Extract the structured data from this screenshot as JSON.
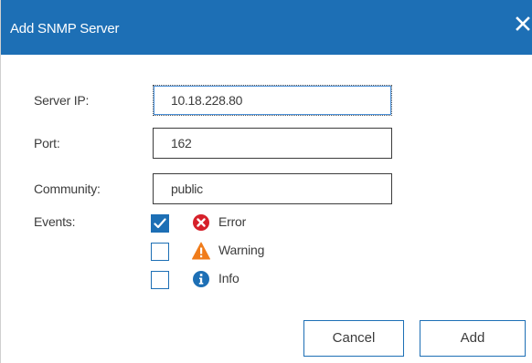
{
  "dialog": {
    "title": "Add SNMP Server",
    "close_glyph": "✕"
  },
  "form": {
    "server_ip_label": "Server IP:",
    "server_ip_value": "10.18.228.80",
    "port_label": "Port:",
    "port_value": "162",
    "community_label": "Community:",
    "community_value": "public",
    "events_label": "Events:"
  },
  "events": [
    {
      "label": "Error",
      "checked": true,
      "icon": "error-icon"
    },
    {
      "label": "Warning",
      "checked": false,
      "icon": "warning-icon"
    },
    {
      "label": "Info",
      "checked": false,
      "icon": "info-icon"
    }
  ],
  "buttons": {
    "cancel_label": "Cancel",
    "add_label": "Add"
  },
  "colors": {
    "accent": "#1d6fb5",
    "error": "#d6202a",
    "warning": "#f07c1b",
    "info": "#1d6fb5"
  }
}
